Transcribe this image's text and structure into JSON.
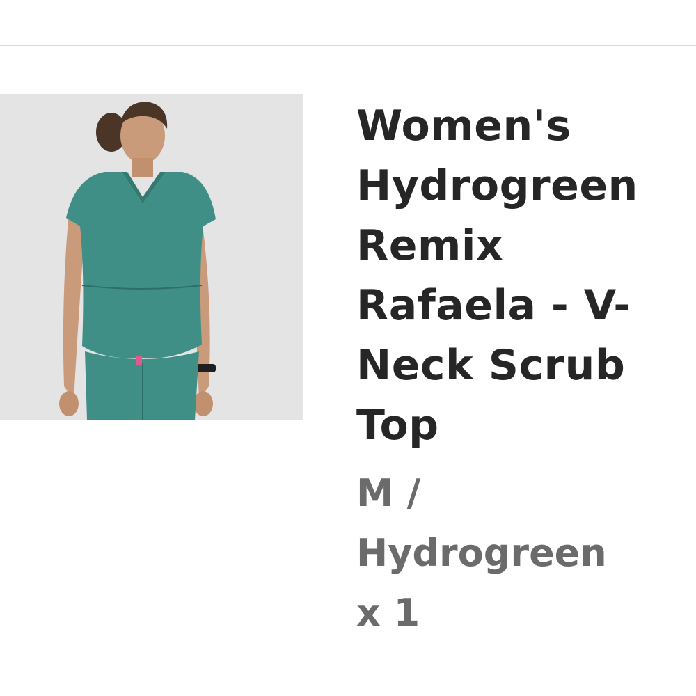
{
  "product": {
    "title": "Women's Hydrogreen Remix Rafaela - V-Neck Scrub Top",
    "variant": "M / Hydrogreen",
    "quantity": "x 1",
    "image_alt": "Women's Hydrogreen Remix Rafaela - V-Neck Scrub Top",
    "scrub_color": "#3f8f86",
    "background_color": "#e3e3e3"
  }
}
